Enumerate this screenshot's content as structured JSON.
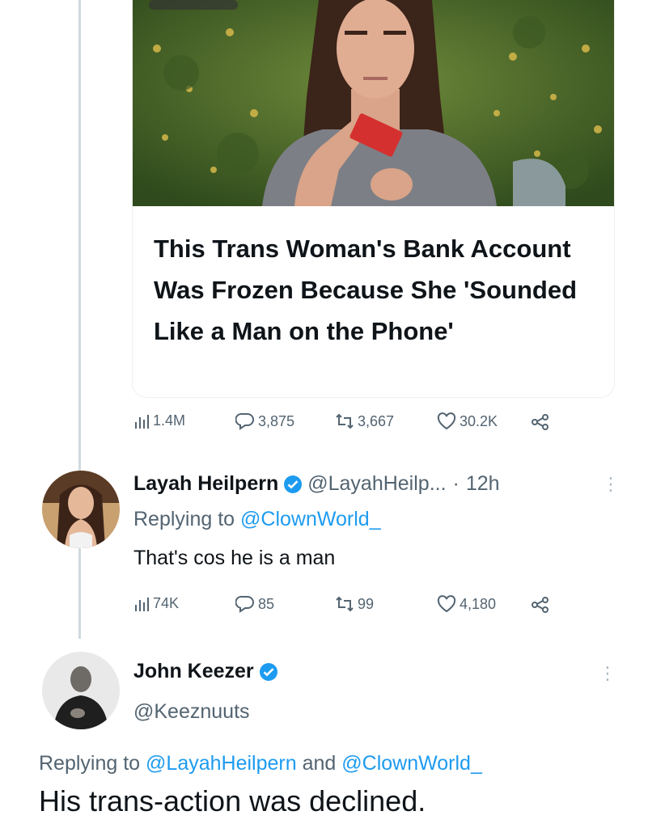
{
  "article": {
    "headline": "This Trans Woman's Bank Account Was Frozen Because She 'Sounded Like a Man on the Phone'"
  },
  "quoted_stats": {
    "views": "1.4M",
    "replies": "3,875",
    "retweets": "3,667",
    "likes": "30.2K"
  },
  "reply1": {
    "name": "Layah Heilpern",
    "handle": "@LayahHeilp...",
    "separator": "·",
    "time": "12h",
    "replying_prefix": "Replying to",
    "replying_to": "@ClownWorld_",
    "text": "That's cos he is a man",
    "stats": {
      "views": "74K",
      "replies": "85",
      "retweets": "99",
      "likes": "4,180"
    }
  },
  "reply2": {
    "name": "John Keezer",
    "handle": "@Keeznuuts",
    "replying_prefix": "Replying to",
    "replying_to_1": "@LayahHeilpern",
    "and_word": "and",
    "replying_to_2": "@ClownWorld_",
    "text": "His trans-action was declined."
  },
  "colors": {
    "accent": "#1d9bf0",
    "muted": "#536471",
    "text": "#0f1419",
    "thread_line": "#cfd9de"
  },
  "icons": [
    "views-icon",
    "reply-icon",
    "retweet-icon",
    "like-icon",
    "share-icon",
    "verified-badge-icon",
    "more-options-icon"
  ]
}
